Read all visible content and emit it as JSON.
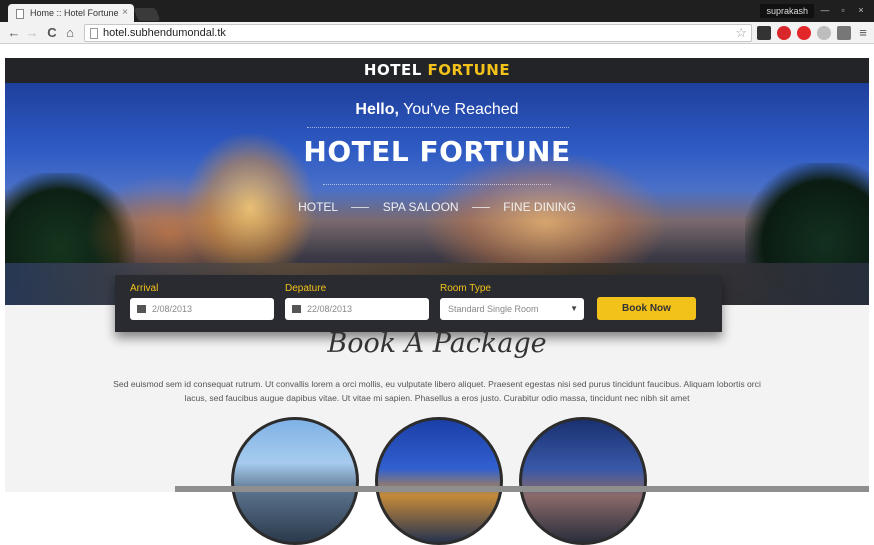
{
  "browser": {
    "tab_title": "Home :: Hotel Fortune",
    "tab_close": "×",
    "profile_name": "suprakash",
    "url": "hotel.subhendumondal.tk",
    "win_minimize": "—",
    "win_restore": "▫",
    "win_close": "×",
    "back_glyph": "←",
    "forward_glyph": "→",
    "reload_glyph": "C",
    "home_glyph": "⌂",
    "star_glyph": "☆",
    "menu_glyph": "≡"
  },
  "site": {
    "logo_part1": "HOTEL ",
    "logo_part2": "FORTUNE",
    "brand_color": "#f2c21b"
  },
  "hero": {
    "hello": "Hello,",
    "reached": " You've Reached",
    "title": "HOTEL FORTUNE",
    "nav": [
      "HOTEL",
      "SPA SALOON",
      "FINE DINING"
    ]
  },
  "booking": {
    "arrival_label": "Arrival",
    "arrival_value": "2/08/2013",
    "departure_label": "Depature",
    "departure_value": "22/08/2013",
    "room_type_label": "Room Type",
    "room_type_value": "Standard Single Room",
    "book_button": "Book Now"
  },
  "package": {
    "title": "Book A Package",
    "paragraph": "Sed euismod sem id consequat rutrum. Ut convallis lorem a orci mollis, eu vulputate libero aliquet. Praesent egestas nisi sed purus tincidunt faucibus. Aliquam lobortis orci lacus, sed faucibus augue dapibus vitae. Ut vitae mi sapien. Phasellus a eros justo. Curabitur odio massa, tincidunt nec nibh sit amet"
  }
}
